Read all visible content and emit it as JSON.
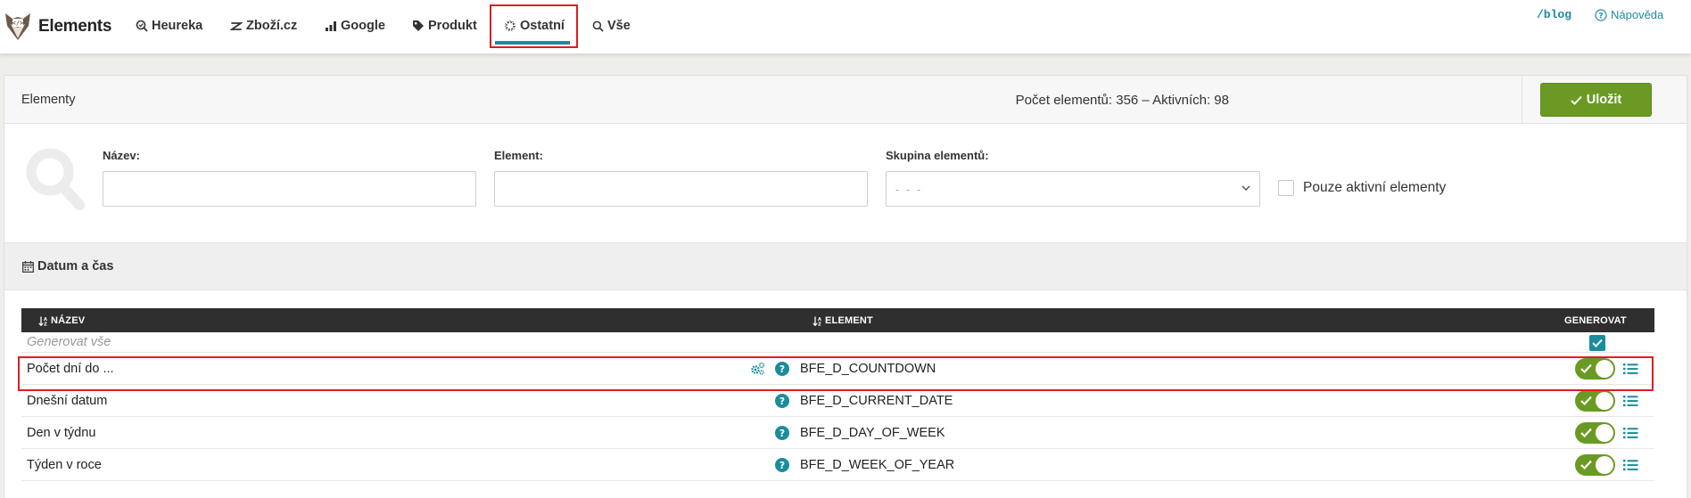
{
  "app": {
    "name": "Elements"
  },
  "nav": {
    "items": [
      {
        "label": "Heureka",
        "icon": "heureka-icon"
      },
      {
        "label": "Zboží.cz",
        "icon": "zbozi-icon"
      },
      {
        "label": "Google",
        "icon": "bar-chart-icon"
      },
      {
        "label": "Produkt",
        "icon": "tag-icon"
      },
      {
        "label": "Ostatní",
        "icon": "gear-icon",
        "active": true
      },
      {
        "label": "Vše",
        "icon": "search-icon"
      }
    ],
    "blog": "/blog",
    "help": "Nápověda"
  },
  "card": {
    "title": "Elementy",
    "stats": "Počet elementů: 356 – Aktivních: 98",
    "save_label": "Uložit"
  },
  "filters": {
    "name_label": "Název:",
    "name_value": "",
    "element_label": "Element:",
    "element_value": "",
    "group_label": "Skupina elementů:",
    "group_value": "- - -",
    "active_only_label": "Pouze aktivní elementy",
    "active_only_checked": false
  },
  "group": {
    "title": "Datum a čas",
    "icon": "calendar-icon"
  },
  "table": {
    "columns": {
      "name": "NÁZEV",
      "element": "ELEMENT",
      "generate": "GENEROVAT"
    },
    "generate_all": {
      "label": "Generovat vše",
      "checked": true
    },
    "rows": [
      {
        "name": "Počet dní do ...",
        "element": "BFE_D_COUNTDOWN",
        "has_settings": true,
        "active": true
      },
      {
        "name": "Dnešní datum",
        "element": "BFE_D_CURRENT_DATE",
        "has_settings": false,
        "active": true
      },
      {
        "name": "Den v týdnu",
        "element": "BFE_D_DAY_OF_WEEK",
        "has_settings": false,
        "active": true
      },
      {
        "name": "Týden v roce",
        "element": "BFE_D_WEEK_OF_YEAR",
        "has_settings": false,
        "active": true
      }
    ]
  },
  "colors": {
    "accent": "#1a8c9c",
    "primary_green": "#6a9a23",
    "highlight_red": "#e01b24",
    "table_header": "#2f2f2f"
  }
}
